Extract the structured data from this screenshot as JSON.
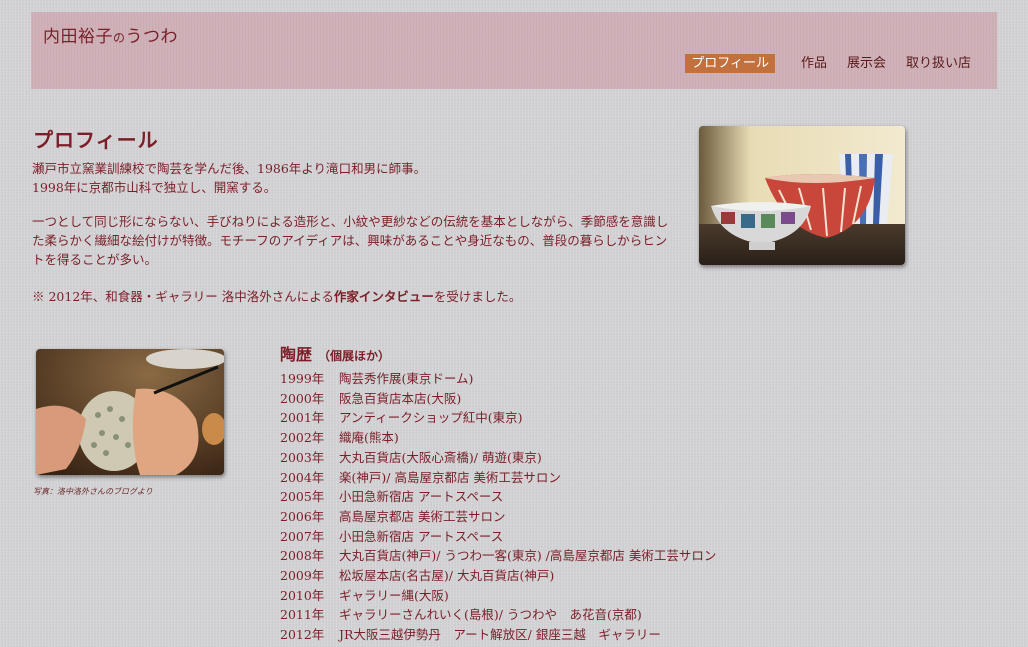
{
  "site": {
    "title_main": "内田裕子",
    "title_small": "の",
    "title_end": "うつわ"
  },
  "nav": {
    "items": [
      {
        "label": "プロフィール",
        "active": true
      },
      {
        "label": "作品",
        "active": false
      },
      {
        "label": "展示会",
        "active": false
      },
      {
        "label": "取り扱い店",
        "active": false
      }
    ]
  },
  "profile": {
    "heading": "プロフィール",
    "p1_line1": "瀬戸市立窯業訓練校で陶芸を学んだ後、1986年より滝口和男に師事。",
    "p1_line2": "1998年に京都市山科で独立し、開窯する。",
    "p2": "一つとして同じ形にならない、手びねりによる造形と、小紋や更紗などの伝統を基本としながら、季節感を意識した柔らかく繊細な絵付けが特徴。モチーフのアイディアは、興味があることや身近なもの、普段の暮らしからヒントを得ることが多い。",
    "p3_before": "※ 2012年、和食器・ギャラリー 洛中洛外さんによる",
    "p3_link": "作家インタビュー",
    "p3_after": "を受けました。"
  },
  "photo_caption": "写真：洛中洛外さんのブログより",
  "history": {
    "heading": "陶歴",
    "subheading": "（個展ほか）",
    "rows": [
      {
        "year": "1999年",
        "text": "陶芸秀作展(東京ドーム)"
      },
      {
        "year": "2000年",
        "text": "阪急百貨店本店(大阪)"
      },
      {
        "year": "2001年",
        "text": "アンティークショップ紅中(東京)"
      },
      {
        "year": "2002年",
        "text": "織庵(熊本)"
      },
      {
        "year": "2003年",
        "text": "大丸百貨店(大阪心斎橋)/ 萌遊(東京)"
      },
      {
        "year": "2004年",
        "text": "楽(神戸)/ 高島屋京都店 美術工芸サロン"
      },
      {
        "year": "2005年",
        "text": "小田急新宿店 アートスペース"
      },
      {
        "year": "2006年",
        "text": "高島屋京都店 美術工芸サロン"
      },
      {
        "year": "2007年",
        "text": "小田急新宿店 アートスペース"
      },
      {
        "year": "2008年",
        "text": "大丸百貨店(神戸)/ うつわ一客(東京) /高島屋京都店 美術工芸サロン"
      },
      {
        "year": "2009年",
        "text": "松坂屋本店(名古屋)/ 大丸百貨店(神戸)"
      },
      {
        "year": "2010年",
        "text": "ギャラリー縄(大阪)"
      },
      {
        "year": "2011年",
        "text": "ギャラリーさんれいく(島根)/ うつわや　あ花音(京都)"
      },
      {
        "year": "2012年",
        "text": "JR大阪三越伊勢丹　アート解放区/ 銀座三越　ギャラリー"
      }
    ]
  },
  "colors": {
    "accent": "#c2713e",
    "text": "#7a1f28",
    "header_bg": "#d9a8b0"
  }
}
